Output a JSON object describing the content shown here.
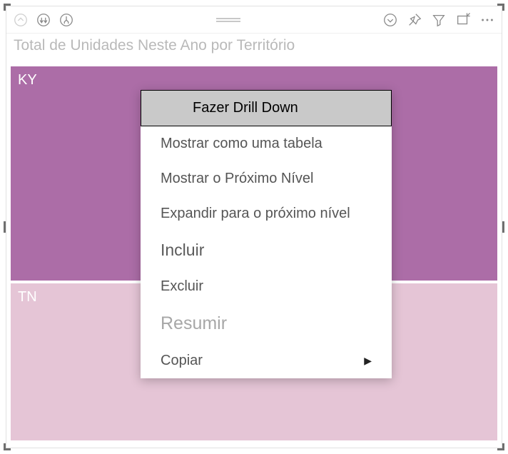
{
  "title": "Total de Unidades Neste Ano por Território",
  "icons": {
    "drill_up": "drill-up-icon",
    "drill_all": "drill-all-down-icon",
    "drill_one": "drill-one-down-icon",
    "drill_down_circle": "drill-down-circle-icon",
    "pin": "pin-icon",
    "filter": "filter-icon",
    "focus": "focus-mode-icon",
    "more": "more-options-icon"
  },
  "chart_data": {
    "type": "treemap",
    "title": "Total de Unidades Neste Ano por Território",
    "series": [
      {
        "name": "KY",
        "value": 58,
        "color": "#ac6da7"
      },
      {
        "name": "TN",
        "value": 42,
        "color": "#e5c5d6"
      }
    ],
    "note": "values estimated from relative cell heights; exact numbers not labeled"
  },
  "context_menu": {
    "items": [
      {
        "label": "Fazer Drill Down",
        "state": "highlight"
      },
      {
        "label": "Mostrar como uma tabela",
        "state": "normal"
      },
      {
        "label": "Mostrar o Próximo Nível",
        "state": "normal"
      },
      {
        "label": "Expandir para o próximo nível",
        "state": "normal"
      },
      {
        "label": "Incluir",
        "state": "special"
      },
      {
        "label": "Excluir",
        "state": "normal"
      },
      {
        "label": "Resumir",
        "state": "dim"
      },
      {
        "label": "Copiar",
        "state": "normal",
        "submenu": true
      }
    ]
  }
}
